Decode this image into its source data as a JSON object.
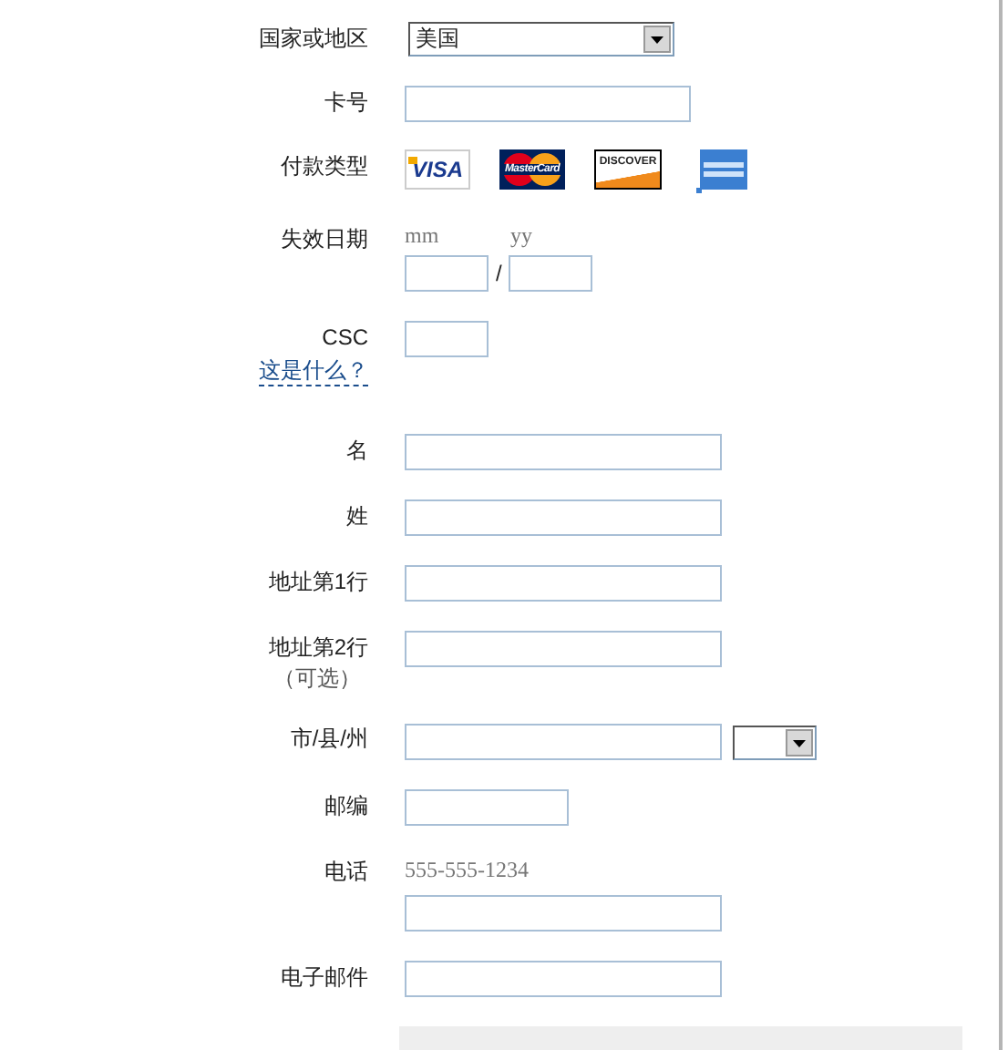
{
  "form": {
    "rows": [
      {
        "kind": "select",
        "label": "国家或地区",
        "value": "美国"
      },
      {
        "kind": "cardfield",
        "label": "卡号"
      },
      {
        "kind": "cards",
        "label": "付款类型",
        "cards": [
          {
            "kind": "visa",
            "text": "VISA"
          },
          {
            "kind": "mastercard",
            "text": "MasterCard"
          },
          {
            "kind": "discover",
            "text": "DISCOVER"
          },
          {
            "kind": "amex"
          }
        ]
      },
      {
        "kind": "expiry",
        "label": "失效日期",
        "month_hint": "mm",
        "separator": "/",
        "year_hint": "yy"
      },
      {
        "kind": "csc",
        "label": "CSC",
        "link": "这是什么？"
      },
      {
        "kind": "field",
        "label": "名"
      },
      {
        "kind": "field",
        "label": "姓"
      },
      {
        "kind": "field",
        "label": "地址第1行"
      },
      {
        "kind": "field",
        "label": "地址第2行",
        "note": "（可选）"
      },
      {
        "kind": "city",
        "label": "市/县/州"
      },
      {
        "kind": "zipfield",
        "label": "邮编"
      },
      {
        "kind": "phone",
        "label": "电话",
        "hint": "555-555-1234"
      },
      {
        "kind": "field",
        "label": "电子邮件"
      }
    ]
  }
}
